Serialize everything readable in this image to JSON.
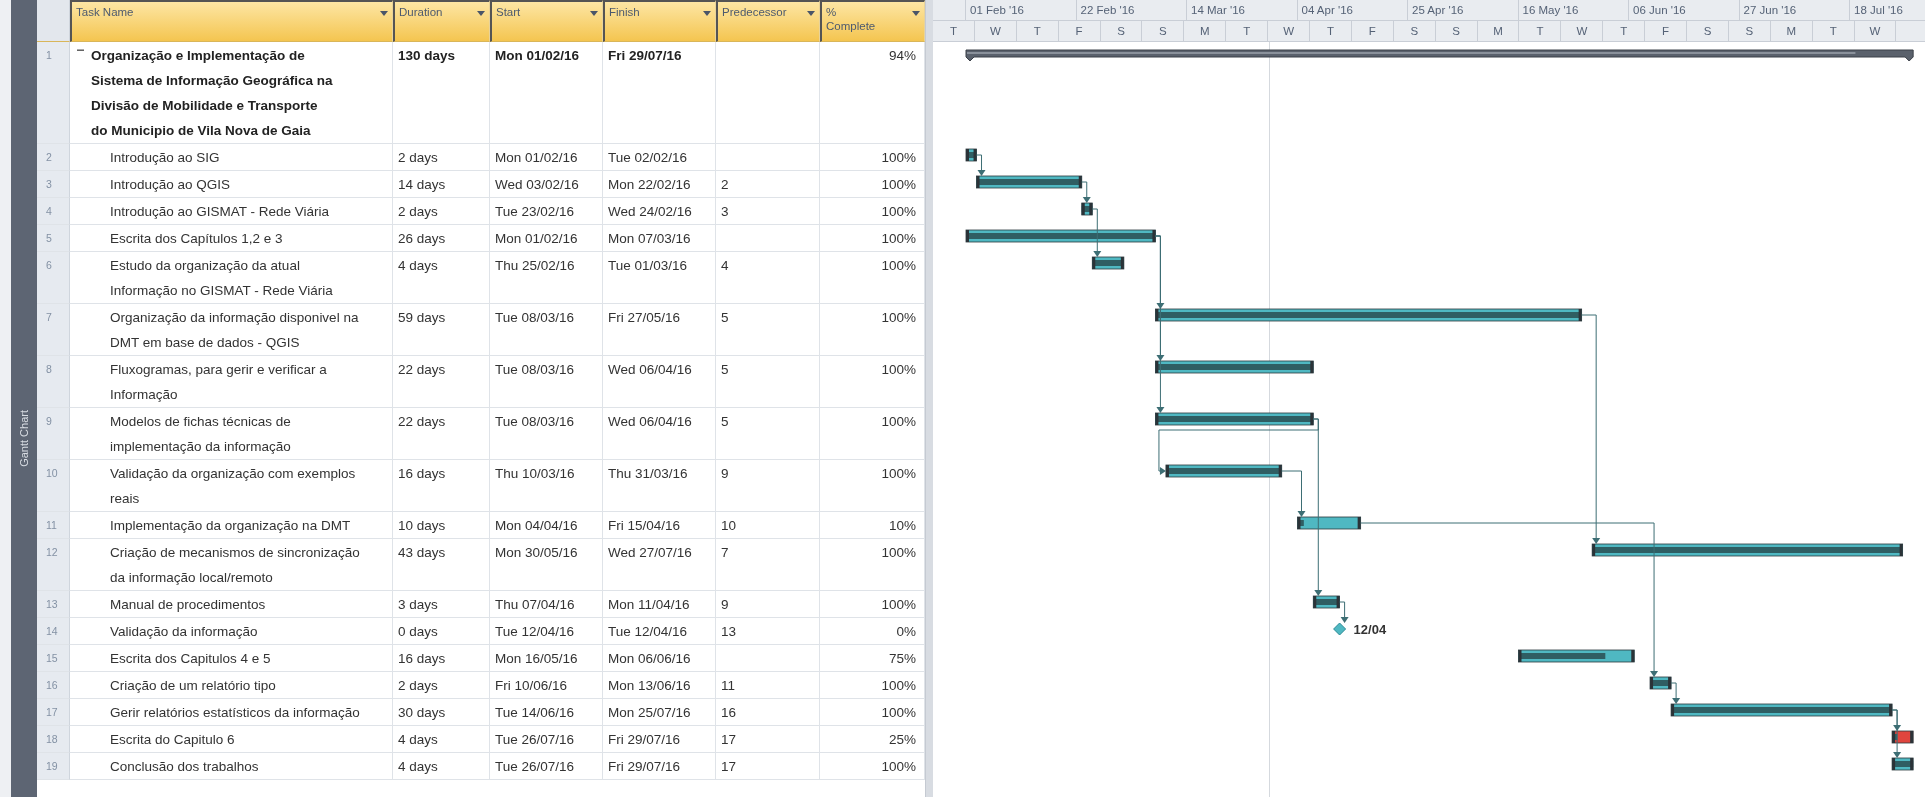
{
  "view_bar": {
    "label": "Gantt Chart"
  },
  "table": {
    "columns": [
      {
        "label": "Task Name"
      },
      {
        "label": "Duration"
      },
      {
        "label": "Start"
      },
      {
        "label": "Finish"
      },
      {
        "label": "Predecessor"
      },
      {
        "label": "% Complete"
      }
    ],
    "rows": [
      {
        "id": "1",
        "kind": "summary",
        "expanded": true,
        "name": "Organização e Implementação de Sistema de Informação Geográfica na Divisão de Mobilidade e Transporte do Municipio de Vila Nova de Gaia",
        "duration": "130 days",
        "start": "Mon 01/02/16",
        "finish": "Fri 29/07/16",
        "complete": "94%"
      },
      {
        "id": "2",
        "kind": "task",
        "color": "#4fb8c2",
        "name": "Introdução ao SIG",
        "duration": "2 days",
        "start": "Mon 01/02/16",
        "finish": "Tue 02/02/16",
        "complete": "100%"
      },
      {
        "id": "3",
        "kind": "task",
        "color": "#4fb8c2",
        "name": "Introdução ao QGIS",
        "duration": "14 days",
        "start": "Wed 03/02/16",
        "finish": "Mon 22/02/16",
        "predecessors": "2",
        "complete": "100%"
      },
      {
        "id": "4",
        "kind": "task",
        "color": "#4fb8c2",
        "name": "Introdução ao GISMAT - Rede Viária",
        "duration": "2 days",
        "start": "Tue 23/02/16",
        "finish": "Wed 24/02/16",
        "predecessors": "3",
        "complete": "100%"
      },
      {
        "id": "5",
        "kind": "task",
        "color": "#4fb8c2",
        "name": "Escrita dos Capítulos 1,2 e 3",
        "duration": "26 days",
        "start": "Mon 01/02/16",
        "finish": "Mon 07/03/16",
        "complete": "100%"
      },
      {
        "id": "6",
        "kind": "task",
        "color": "#4fb8c2",
        "name": "Estudo da organização da atual Informação no GISMAT - Rede Viária",
        "duration": "4 days",
        "start": "Thu 25/02/16",
        "finish": "Tue 01/03/16",
        "predecessors": "4",
        "complete": "100%"
      },
      {
        "id": "7",
        "kind": "task",
        "color": "#4fb8c2",
        "name": "Organização da informação disponivel na DMT em base de dados - QGIS",
        "duration": "59 days",
        "start": "Tue 08/03/16",
        "finish": "Fri 27/05/16",
        "predecessors": "5",
        "complete": "100%"
      },
      {
        "id": "8",
        "kind": "task",
        "color": "#4fb8c2",
        "name": "Fluxogramas, para gerir e verificar a Informação",
        "duration": "22 days",
        "start": "Tue 08/03/16",
        "finish": "Wed 06/04/16",
        "predecessors": "5",
        "complete": "100%"
      },
      {
        "id": "9",
        "kind": "task",
        "color": "#4fb8c2",
        "name": "Modelos de fichas técnicas de implementação da informação",
        "duration": "22 days",
        "start": "Tue 08/03/16",
        "finish": "Wed 06/04/16",
        "predecessors": "5",
        "complete": "100%"
      },
      {
        "id": "10",
        "kind": "task",
        "color": "#4fb8c2",
        "name": "Validação da organização com exemplos reais",
        "duration": "16 days",
        "start": "Thu 10/03/16",
        "finish": "Thu 31/03/16",
        "predecessors": "9",
        "complete": "100%"
      },
      {
        "id": "11",
        "kind": "task",
        "color": "#4fb8c2",
        "name": "Implementação da organização na DMT",
        "duration": "10 days",
        "start": "Mon 04/04/16",
        "finish": "Fri 15/04/16",
        "predecessors": "10",
        "complete": "10%"
      },
      {
        "id": "12",
        "kind": "task",
        "color": "#4fb8c2",
        "name": "Criação de mecanismos de sincronização da informação local/remoto",
        "duration": "43 days",
        "start": "Mon 30/05/16",
        "finish": "Wed 27/07/16",
        "predecessors": "7",
        "complete": "100%"
      },
      {
        "id": "13",
        "kind": "task",
        "color": "#4fb8c2",
        "name": "Manual de procedimentos",
        "duration": "3 days",
        "start": "Thu 07/04/16",
        "finish": "Mon 11/04/16",
        "predecessors": "9",
        "complete": "100%"
      },
      {
        "id": "14",
        "kind": "milestone",
        "color": "#4fb8c2",
        "name": "Validação da informação",
        "duration": "0 days",
        "start": "Tue 12/04/16",
        "finish": "Tue 12/04/16",
        "predecessors": "13",
        "complete": "0%",
        "bar_label": "12/04"
      },
      {
        "id": "15",
        "kind": "task",
        "color": "#4fb8c2",
        "name": "Escrita dos Capitulos 4 e 5",
        "duration": "16 days",
        "start": "Mon 16/05/16",
        "finish": "Mon 06/06/16",
        "complete": "75%"
      },
      {
        "id": "16",
        "kind": "task",
        "color": "#4fb8c2",
        "name": "Criação de um relatório tipo",
        "duration": "2 days",
        "start": "Fri 10/06/16",
        "finish": "Mon 13/06/16",
        "predecessors": "11",
        "complete": "100%"
      },
      {
        "id": "17",
        "kind": "task",
        "color": "#4fb8c2",
        "name": "Gerir relatórios estatísticos da informação",
        "duration": "30 days",
        "start": "Tue 14/06/16",
        "finish": "Mon 25/07/16",
        "predecessors": "16",
        "complete": "100%"
      },
      {
        "id": "18",
        "kind": "task",
        "color": "#e0453e",
        "name": "Escrita  do Capitulo 6",
        "duration": "4 days",
        "start": "Tue 26/07/16",
        "finish": "Fri 29/07/16",
        "predecessors": "17",
        "complete": "25%"
      },
      {
        "id": "19",
        "kind": "task",
        "color": "#4fb8c2",
        "name": "Conclusão dos trabalhos",
        "duration": "4 days",
        "start": "Tue 26/07/16",
        "finish": "Fri 29/07/16",
        "predecessors": "17",
        "complete": "100%"
      }
    ]
  },
  "timescale": {
    "major": [
      "01 Feb '16",
      "22 Feb '16",
      "14 Mar '16",
      "04 Apr '16",
      "25 Apr '16",
      "16 May '16",
      "06 Jun '16",
      "27 Jun '16",
      "18 Jul '16"
    ],
    "minor": [
      "T",
      "W",
      "T",
      "F",
      "S",
      "S",
      "M",
      "T",
      "W",
      "T",
      "F",
      "S",
      "S",
      "M",
      "T",
      "W",
      "T",
      "F",
      "S",
      "S",
      "M",
      "T",
      "W"
    ]
  }
}
